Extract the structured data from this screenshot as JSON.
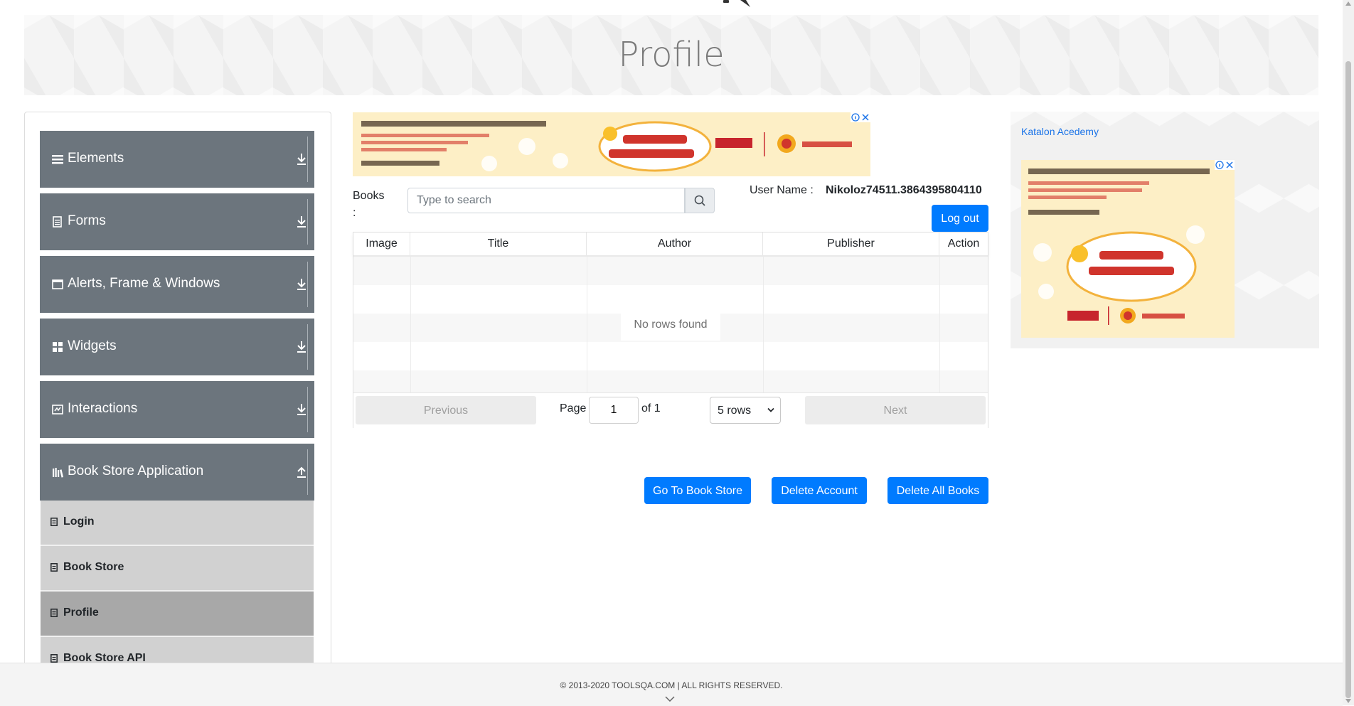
{
  "header": {
    "title": "Profile"
  },
  "sidebar": {
    "groups": [
      {
        "label": "Elements",
        "icon": "list-icon"
      },
      {
        "label": "Forms",
        "icon": "form-icon"
      },
      {
        "label": "Alerts, Frame & Windows",
        "icon": "window-icon"
      },
      {
        "label": "Widgets",
        "icon": "widgets-icon"
      },
      {
        "label": "Interactions",
        "icon": "interactions-icon"
      },
      {
        "label": "Book Store Application",
        "icon": "books-icon"
      }
    ],
    "book_store_items": [
      {
        "label": "Login"
      },
      {
        "label": "Book Store"
      },
      {
        "label": "Profile",
        "active": true
      },
      {
        "label": "Book Store API"
      }
    ]
  },
  "books": {
    "label": "Books :",
    "search_placeholder": "Type to search"
  },
  "user": {
    "label": "User Name :",
    "value": "Nikoloz74511.3864395804110",
    "logout_label": "Log out"
  },
  "table": {
    "columns": [
      "Image",
      "Title",
      "Author",
      "Publisher",
      "Action"
    ],
    "empty_message": "No rows found"
  },
  "pagination": {
    "previous_label": "Previous",
    "page_label": "Page",
    "current_page": "1",
    "of_label": "of 1",
    "rows_option": "5 rows",
    "next_label": "Next"
  },
  "actions": {
    "go_to_store": "Go To Book Store",
    "delete_account": "Delete Account",
    "delete_all_books": "Delete All Books"
  },
  "right_ad": {
    "katalon_link": "Katalon Acedemy"
  },
  "footer": {
    "text": "© 2013-2020 TOOLSQA.COM | ALL RIGHTS RESERVED."
  },
  "colors": {
    "sidebar_group_bg": "#6c757d",
    "primary_button": "#007bff",
    "submenu_bg": "#d1d1d1",
    "submenu_active_bg": "#a8a8a8"
  }
}
